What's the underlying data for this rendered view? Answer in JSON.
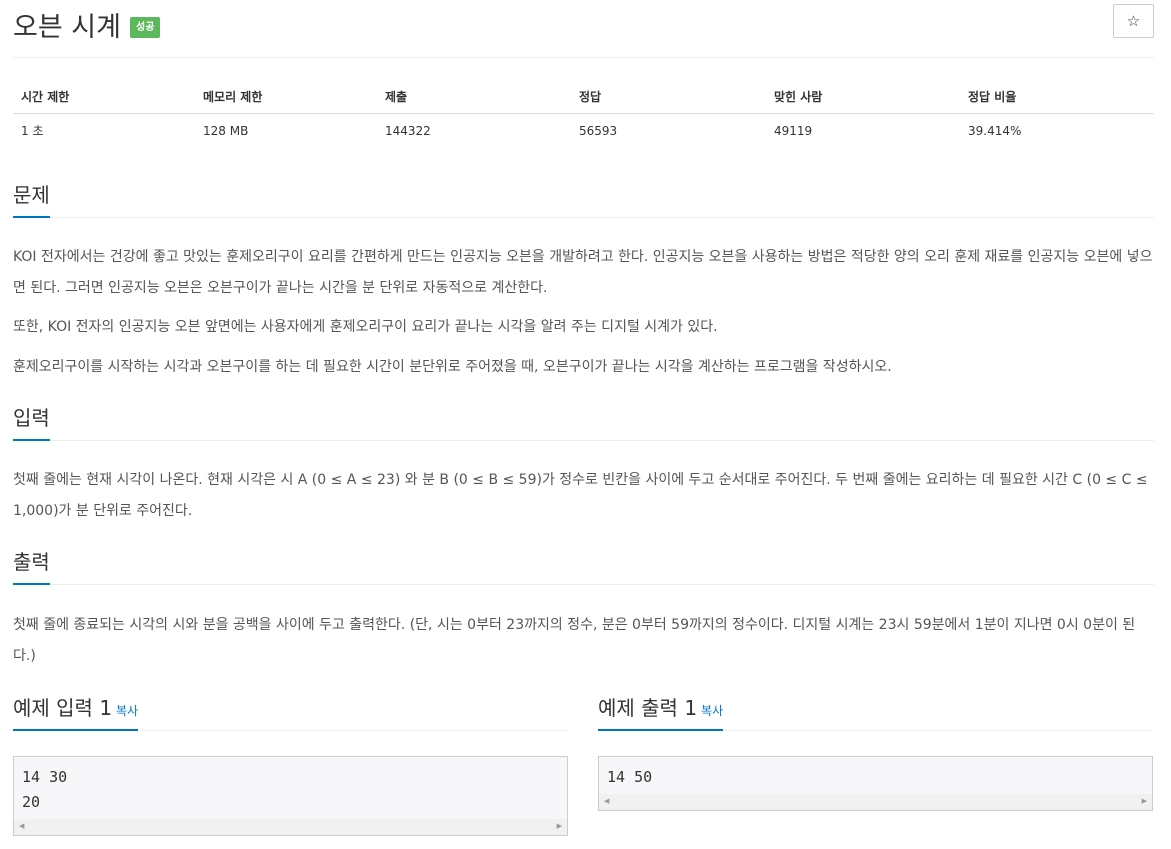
{
  "header": {
    "title": "오븐 시계",
    "badge": "성공",
    "star_icon": "☆"
  },
  "info": {
    "headers": [
      "시간 제한",
      "메모리 제한",
      "제출",
      "정답",
      "맞힌 사람",
      "정답 비율"
    ],
    "values": [
      "1 초",
      "128 MB",
      "144322",
      "56593",
      "49119",
      "39.414%"
    ]
  },
  "sections": {
    "problem": {
      "title": "문제",
      "paragraphs": [
        "KOI 전자에서는 건강에 좋고 맛있는 훈제오리구이 요리를 간편하게 만드는 인공지능 오븐을 개발하려고 한다. 인공지능 오븐을 사용하는 방법은 적당한 양의 오리 훈제 재료를 인공지능 오븐에 넣으면 된다. 그러면 인공지능 오븐은 오븐구이가 끝나는 시간을 분 단위로 자동적으로 계산한다.",
        "또한, KOI 전자의 인공지능 오븐 앞면에는 사용자에게 훈제오리구이 요리가 끝나는 시각을 알려 주는 디지털 시계가 있다.",
        "훈제오리구이를 시작하는 시각과 오븐구이를 하는 데 필요한 시간이 분단위로 주어졌을 때, 오븐구이가 끝나는 시각을 계산하는 프로그램을 작성하시오."
      ]
    },
    "input": {
      "title": "입력",
      "text": "첫째 줄에는 현재 시각이 나온다. 현재 시각은 시 A (0 ≤ A ≤ 23) 와 분 B (0 ≤ B ≤ 59)가 정수로 빈칸을 사이에 두고 순서대로 주어진다. 두 번째 줄에는 요리하는 데 필요한 시간 C (0 ≤ C ≤ 1,000)가 분 단위로 주어진다."
    },
    "output": {
      "title": "출력",
      "text": "첫째 줄에 종료되는 시각의 시와 분을 공백을 사이에 두고 출력한다. (단, 시는 0부터 23까지의 정수, 분은 0부터 59까지의 정수이다. 디지털 시계는 23시 59분에서 1분이 지나면 0시 0분이 된다.)"
    }
  },
  "samples": {
    "input": {
      "title": "예제 입력 1",
      "copy": "복사",
      "content": "14 30\n20"
    },
    "output": {
      "title": "예제 출력 1",
      "copy": "복사",
      "content": "14 50"
    }
  },
  "colors": {
    "accent": "#0076c0",
    "badge": "#5cb85c"
  }
}
